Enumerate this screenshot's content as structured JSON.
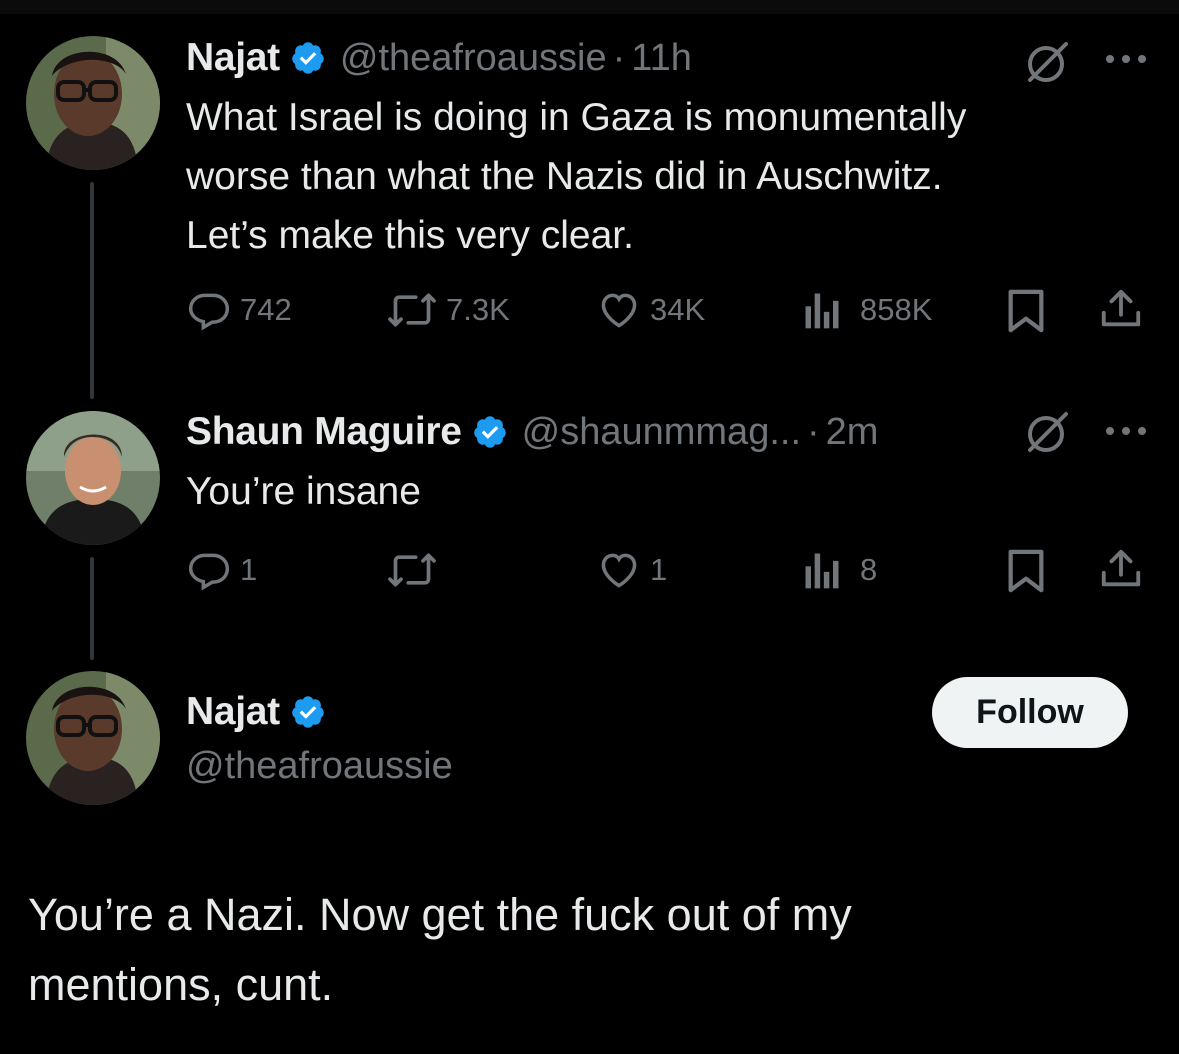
{
  "tweets": [
    {
      "name": "Najat",
      "handle": "@theafroaussie",
      "dot": "·",
      "time": "11h",
      "text": "What Israel is doing in Gaza is monumentally\nworse than what the Nazis did in Auschwitz.\nLet’s make this very clear.",
      "replies": "742",
      "reposts": "7.3K",
      "likes": "34K",
      "views": "858K"
    },
    {
      "name": "Shaun Maguire",
      "handle": "@shaunmmag...",
      "dot": "·",
      "time": "2m",
      "text": "You’re insane",
      "replies": "1",
      "reposts": "",
      "likes": "1",
      "views": "8"
    }
  ],
  "main_post": {
    "name": "Najat",
    "handle": "@theafroaussie",
    "follow_label": "Follow",
    "text": "You’re a Nazi. Now get the fuck out of my\nmentions, cunt."
  },
  "icons": {
    "verified": "verified-badge-icon",
    "grok": "grok-icon",
    "more": "more-icon",
    "reply": "reply-icon",
    "repost": "repost-icon",
    "like": "like-icon",
    "views": "views-icon",
    "bookmark": "bookmark-icon",
    "share": "share-icon"
  },
  "colors": {
    "background": "#000000",
    "text": "#e7e9ea",
    "secondary": "#71767b",
    "verified": "#1d9bf0",
    "follow_bg": "#eff3f4"
  }
}
